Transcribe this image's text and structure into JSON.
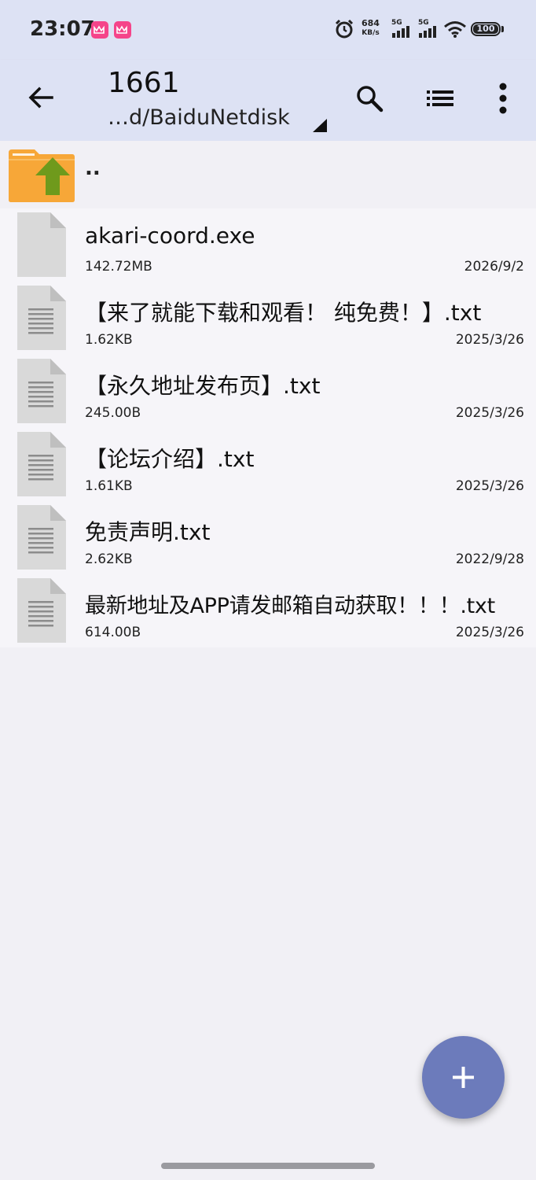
{
  "status_bar": {
    "time": "23:07",
    "notification_icons": [
      "app-icon",
      "app-icon"
    ],
    "net_speed_value": "684",
    "net_speed_unit": "KB/s",
    "signal_1_label": "5G",
    "signal_2_label": "5G",
    "battery": "100"
  },
  "app_bar": {
    "title": "1661",
    "path": "…d/BaiduNetdisk",
    "icons": [
      "back-arrow-icon",
      "search-icon",
      "list-view-icon",
      "more-vert-icon"
    ]
  },
  "parent_dir": {
    "name": ".."
  },
  "files": [
    {
      "name": "akari-coord.exe",
      "size": "142.72MB",
      "date": "2026/9/2",
      "icon": "blank-file-icon"
    },
    {
      "name": "【来了就能下载和观看！ 纯免费！】.txt",
      "size": "1.62KB",
      "date": "2025/3/26",
      "icon": "text-file-icon"
    },
    {
      "name": "【永久地址发布页】.txt",
      "size": "245.00B",
      "date": "2025/3/26",
      "icon": "text-file-icon"
    },
    {
      "name": "【论坛介绍】.txt",
      "size": "1.61KB",
      "date": "2025/3/26",
      "icon": "text-file-icon"
    },
    {
      "name": "免责声明.txt",
      "size": "2.62KB",
      "date": "2022/9/28",
      "icon": "text-file-icon"
    },
    {
      "name": "最新地址及APP请发邮箱自动获取！！！.txt",
      "size": "614.00B",
      "date": "2025/3/26",
      "icon": "text-file-icon"
    }
  ],
  "fab": {
    "icon": "plus-icon"
  },
  "colors": {
    "app_bar_bg": "#dde2f4",
    "page_bg": "#f1f0f5",
    "fab_bg": "#6c7bbb",
    "folder_orange": "#f7a738",
    "folder_arrow_green": "#6f9a1c",
    "file_icon_grey": "#d9d9d9"
  }
}
